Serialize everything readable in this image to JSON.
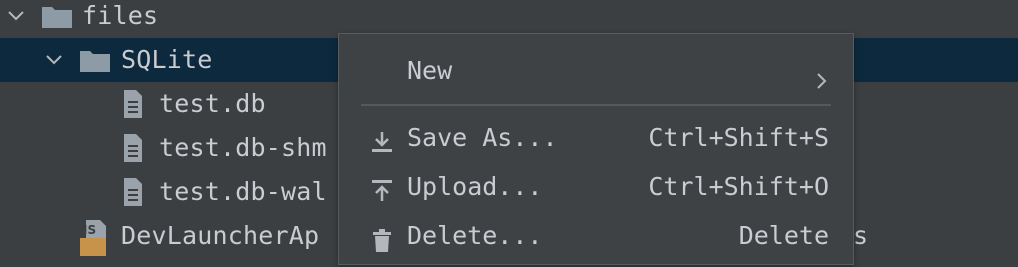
{
  "tree": {
    "items": [
      {
        "label": "files"
      },
      {
        "label": "SQLite"
      },
      {
        "label": "test.db"
      },
      {
        "label": "test.db-shm"
      },
      {
        "label": "test.db-wal"
      },
      {
        "label": "DevLauncherAp",
        "badge": "JS"
      }
    ],
    "trailing_text": "s"
  },
  "context_menu": {
    "items": [
      {
        "label": "New",
        "icon": "none",
        "submenu": true
      },
      {
        "label": "Save As...",
        "shortcut": "Ctrl+Shift+S",
        "icon": "download-icon"
      },
      {
        "label": "Upload...",
        "shortcut": "Ctrl+Shift+O",
        "icon": "upload-icon"
      },
      {
        "label": "Delete...",
        "shortcut": "Delete",
        "icon": "trash-icon"
      }
    ]
  },
  "colors": {
    "background": "#3c3f41",
    "selection": "#0d293e",
    "folder": "#8c9ba6",
    "text": "#c9ccd0",
    "js_badge": "#c7924a"
  }
}
